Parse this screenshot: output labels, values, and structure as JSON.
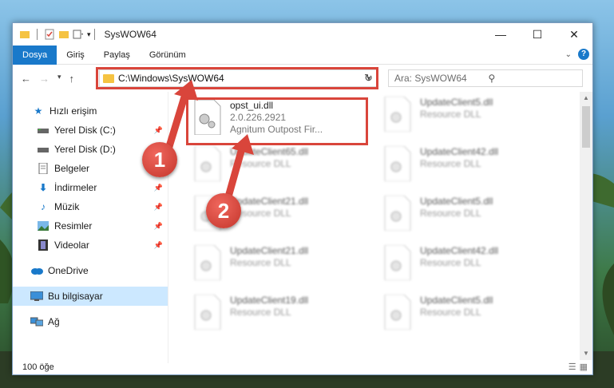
{
  "window": {
    "title": "SysWOW64"
  },
  "ribbon": {
    "tabs": [
      {
        "label": "Dosya"
      },
      {
        "label": "Giriş"
      },
      {
        "label": "Paylaş"
      },
      {
        "label": "Görünüm"
      }
    ]
  },
  "address": {
    "path": "C:\\Windows\\SysWOW64",
    "search_placeholder": "Ara: SysWOW64"
  },
  "sidebar": {
    "items": [
      {
        "label": "Hızlı erişim",
        "icon": "star-icon"
      },
      {
        "label": "Yerel Disk (C:)",
        "icon": "drive-icon"
      },
      {
        "label": "Yerel Disk (D:)",
        "icon": "drive-icon"
      },
      {
        "label": "Belgeler",
        "icon": "document-icon"
      },
      {
        "label": "İndirmeler",
        "icon": "download-icon"
      },
      {
        "label": "Müzik",
        "icon": "music-icon"
      },
      {
        "label": "Resimler",
        "icon": "pictures-icon"
      },
      {
        "label": "Videolar",
        "icon": "video-icon"
      },
      {
        "label": "OneDrive",
        "icon": "cloud-icon"
      },
      {
        "label": "Bu bilgisayar",
        "icon": "computer-icon"
      },
      {
        "label": "Ağ",
        "icon": "network-icon"
      }
    ]
  },
  "files": {
    "highlighted": {
      "name": "opst_ui.dll",
      "version": "2.0.226.2921",
      "company": "Agnitum Outpost Fir..."
    },
    "left_column": [
      {
        "name": "UpdateClient65.dll",
        "type": "Resource DLL"
      },
      {
        "name": "UpdateClient21.dll",
        "type": "Resource DLL"
      },
      {
        "name": "UpdateClient21.dll",
        "type": "Resource DLL"
      },
      {
        "name": "UpdateClient19.dll",
        "type": "Resource DLL"
      }
    ],
    "right_column": [
      {
        "name": "UpdateClient5.dll",
        "type": "Resource DLL"
      },
      {
        "name": "UpdateClient42.dll",
        "type": "Resource DLL"
      },
      {
        "name": "UpdateClient5.dll",
        "type": "Resource DLL"
      },
      {
        "name": "UpdateClient42.dll",
        "type": "Resource DLL"
      },
      {
        "name": "UpdateClient5.dll",
        "type": "Resource DLL"
      }
    ]
  },
  "status": {
    "count": "100 öğe"
  },
  "steps": {
    "one": "1",
    "two": "2"
  },
  "colors": {
    "accent": "#1979ca",
    "highlight": "#d9453b",
    "selection": "#cce8ff"
  }
}
